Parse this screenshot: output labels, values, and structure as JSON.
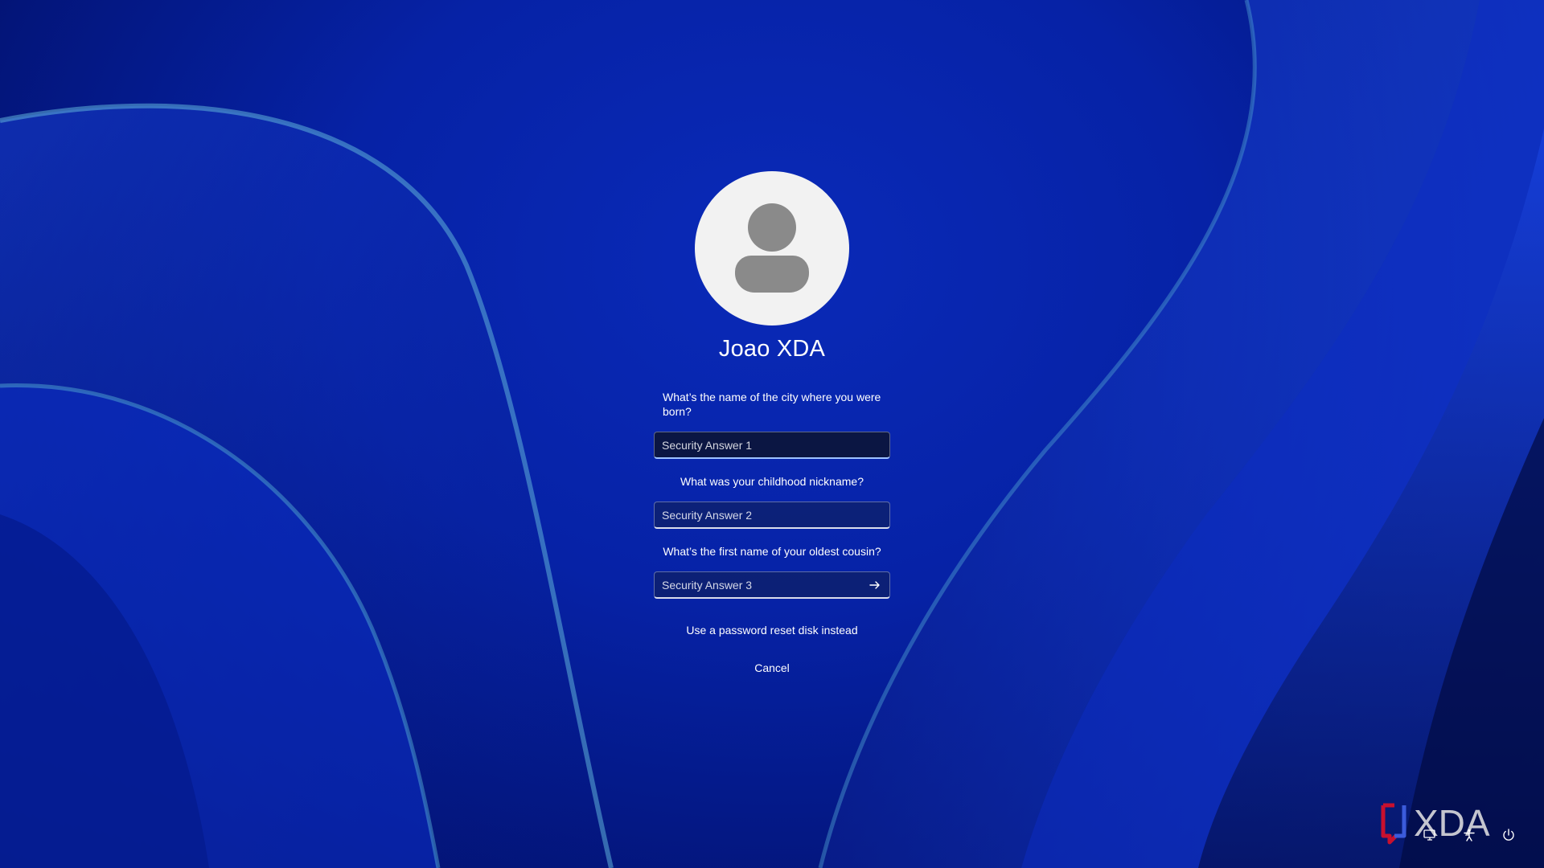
{
  "user": {
    "name": "Joao XDA"
  },
  "security_questions": [
    {
      "question": "What’s the name of the city where you were born?",
      "answer_value": "",
      "answer_placeholder": "Security Answer 1"
    },
    {
      "question": "What was your childhood nickname?",
      "answer_value": "",
      "answer_placeholder": "Security Answer 2"
    },
    {
      "question": "What’s the first name of your oldest cousin?",
      "answer_value": "",
      "answer_placeholder": "Security Answer 3"
    }
  ],
  "links": {
    "reset_disk": "Use a password reset disk instead",
    "cancel": "Cancel"
  },
  "watermark": {
    "text": "XDA"
  },
  "icons": {
    "avatar": "user-icon",
    "submit": "arrow-right-icon",
    "network": "network-icon",
    "accessibility": "accessibility-icon",
    "power": "power-icon"
  },
  "colors": {
    "background": "#0622a6",
    "accent": "#9ec2ff",
    "watermark_red": "#c8102e",
    "watermark_blue": "#3b5bdb"
  }
}
